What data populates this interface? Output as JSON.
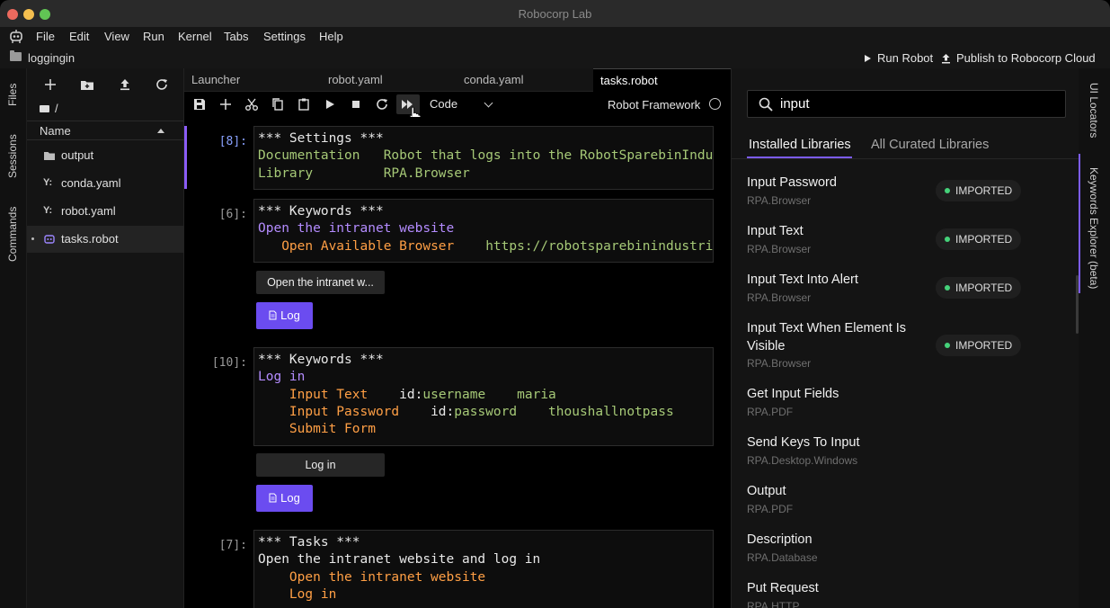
{
  "window": {
    "title": "Robocorp Lab"
  },
  "menu": [
    "File",
    "Edit",
    "View",
    "Run",
    "Kernel",
    "Tabs",
    "Settings",
    "Help"
  ],
  "topbar": {
    "folder": "loggingin",
    "run_robot": "Run Robot",
    "publish": "Publish to Robocorp Cloud"
  },
  "left_rail": [
    "Files",
    "Sessions",
    "Commands"
  ],
  "files": {
    "path": "/",
    "header": "Name",
    "items": [
      {
        "name": "output",
        "icon": "folder-icon"
      },
      {
        "name": "conda.yaml",
        "icon": "yaml-icon"
      },
      {
        "name": "robot.yaml",
        "icon": "yaml-icon"
      },
      {
        "name": "tasks.robot",
        "icon": "robot-icon"
      }
    ]
  },
  "tabs": [
    "Launcher",
    "robot.yaml",
    "conda.yaml",
    "tasks.robot"
  ],
  "toolbar": {
    "cell_type": "Code",
    "kernel": "Robot Framework"
  },
  "cells": {
    "c1": {
      "prompt": "[8]:",
      "l1": "*** Settings ***",
      "l2a": "Documentation",
      "l2b": "Robot that logs into the RobotSparebinIndustries",
      "l3a": "Library",
      "l3b": "RPA.Browser"
    },
    "c2": {
      "prompt": "[6]:",
      "l1": "*** Keywords ***",
      "l2": "Open the intranet website",
      "l3a": "Open Available Browser",
      "l3b": "https://robotsparebinindustries.co",
      "out": "Open the intranet w...",
      "log": "Log"
    },
    "c3": {
      "prompt": "[10]:",
      "l1": "*** Keywords ***",
      "l2": "Log in",
      "l3a": "Input Text",
      "l3b": "id:",
      "l3c": "username",
      "l3d": "maria",
      "l4a": "Input Password",
      "l4b": "id:",
      "l4c": "password",
      "l4d": "thoushallnotpass",
      "l5": "Submit Form",
      "out": "Log in",
      "log": "Log"
    },
    "c4": {
      "prompt": "[7]:",
      "l1": "*** Tasks ***",
      "l2": "Open the intranet website and log in",
      "l3": "Open the intranet website",
      "l4": "Log in"
    }
  },
  "explorer": {
    "search_value": "input",
    "tab_installed": "Installed Libraries",
    "tab_curated": "All Curated Libraries",
    "items": [
      {
        "name": "Input Password",
        "lib": "RPA.Browser",
        "badge": "IMPORTED"
      },
      {
        "name": "Input Text",
        "lib": "RPA.Browser",
        "badge": "IMPORTED"
      },
      {
        "name": "Input Text Into Alert",
        "lib": "RPA.Browser",
        "badge": "IMPORTED"
      },
      {
        "name": "Input Text When Element Is Visible",
        "lib": "RPA.Browser",
        "badge": "IMPORTED"
      },
      {
        "name": "Get Input Fields",
        "lib": "RPA.PDF",
        "badge": ""
      },
      {
        "name": "Send Keys To Input",
        "lib": "RPA.Desktop.Windows",
        "badge": ""
      },
      {
        "name": "Output",
        "lib": "RPA.PDF",
        "badge": ""
      },
      {
        "name": "Description",
        "lib": "RPA.Database",
        "badge": ""
      },
      {
        "name": "Put Request",
        "lib": "RPA.HTTP",
        "badge": ""
      }
    ]
  },
  "right_rail": [
    "UI Locators",
    "Keywords Explorer (beta)"
  ],
  "colors": {
    "accent": "#7c5cf4",
    "keyword": "#b48cff",
    "value": "#a6c977",
    "call": "#ff9f45",
    "imported": "#45d27a"
  }
}
